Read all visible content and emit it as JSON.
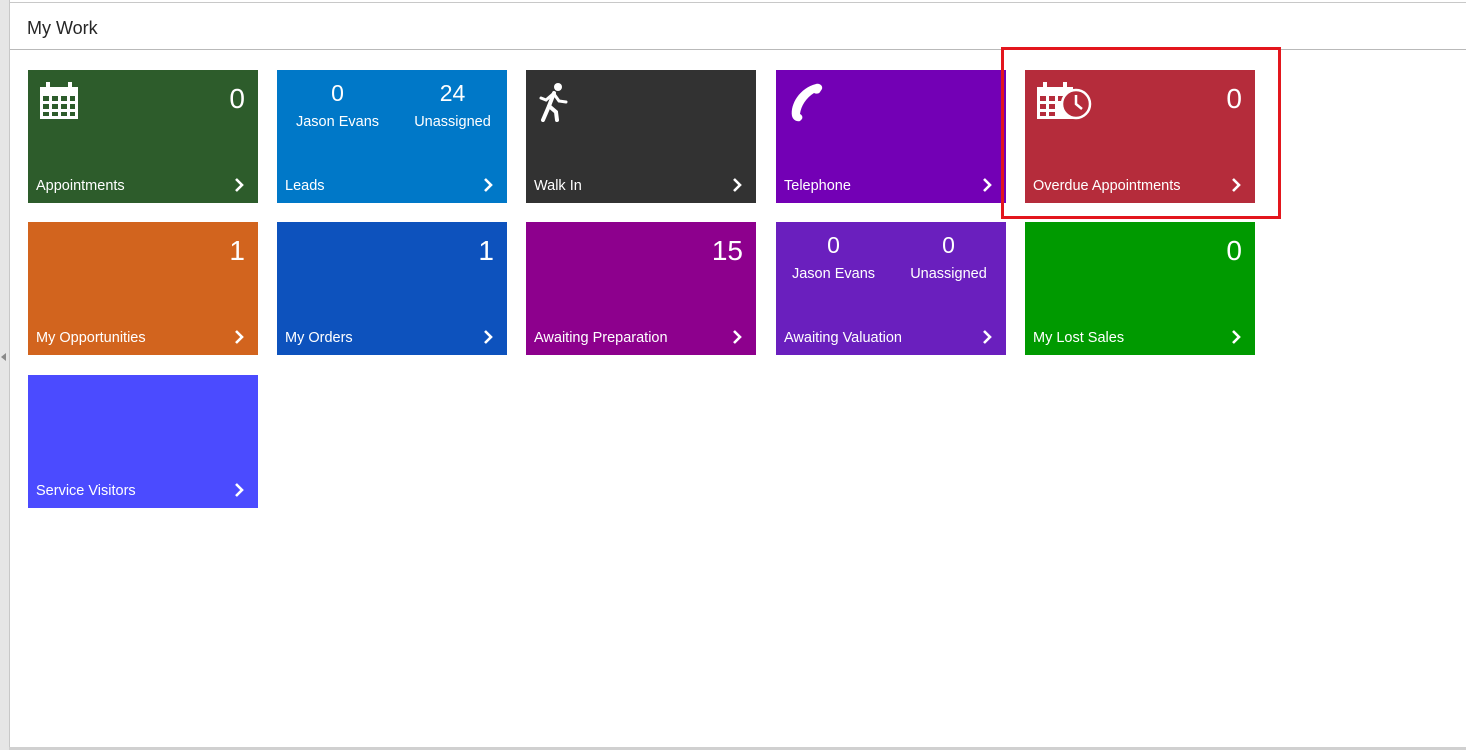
{
  "page": {
    "title": "My Work"
  },
  "colors": {
    "appointments": "#2d5c2b",
    "leads": "#0078c8",
    "walk_in": "#323232",
    "telephone": "#7300b5",
    "overdue": "#b52c3b",
    "opportunities": "#d2641e",
    "orders": "#0d52bd",
    "awaiting_preparation": "#8d008d",
    "awaiting_valuation": "#6a1fbe",
    "lost_sales": "#009a00",
    "service_visitors": "#4b4bff",
    "highlight": "#e3161d"
  },
  "tiles": {
    "appointments": {
      "label": "Appointments",
      "count": "0",
      "icon": "calendar-icon"
    },
    "leads": {
      "label": "Leads",
      "left": {
        "count": "0",
        "name": "Jason Evans"
      },
      "right": {
        "count": "24",
        "name": "Unassigned"
      }
    },
    "walk_in": {
      "label": "Walk In",
      "icon": "walking-person-icon"
    },
    "telephone": {
      "label": "Telephone",
      "icon": "phone-handset-icon"
    },
    "overdue": {
      "label": "Overdue Appointments",
      "count": "0",
      "icon": "calendar-clock-icon"
    },
    "opportunities": {
      "label": "My Opportunities",
      "count": "1"
    },
    "orders": {
      "label": "My Orders",
      "count": "1"
    },
    "awaiting_preparation": {
      "label": "Awaiting Preparation",
      "count": "15"
    },
    "awaiting_valuation": {
      "label": "Awaiting Valuation",
      "left": {
        "count": "0",
        "name": "Jason Evans"
      },
      "right": {
        "count": "0",
        "name": "Unassigned"
      }
    },
    "lost_sales": {
      "label": "My Lost Sales",
      "count": "0"
    },
    "service_visitors": {
      "label": "Service Visitors"
    }
  }
}
